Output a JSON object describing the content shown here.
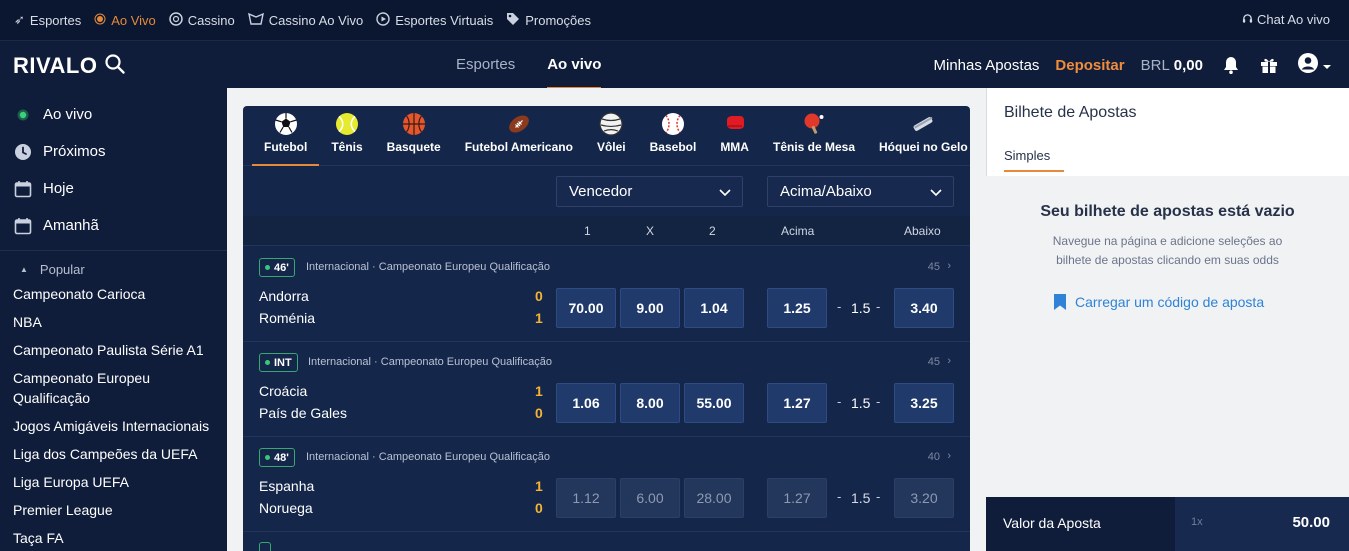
{
  "topbar": {
    "items": [
      {
        "label": "Esportes",
        "icon": "sports-icon"
      },
      {
        "label": "Ao Vivo",
        "icon": "live-dot-icon"
      },
      {
        "label": "Cassino",
        "icon": "casino-chip-icon"
      },
      {
        "label": "Cassino Ao Vivo",
        "icon": "live-casino-icon"
      },
      {
        "label": "Esportes Virtuais",
        "icon": "virtual-sports-icon"
      },
      {
        "label": "Promoções",
        "icon": "tag-icon"
      }
    ],
    "chat_label": "Chat Ao vivo"
  },
  "header": {
    "logo": "RIVALO",
    "nav": [
      "Esportes",
      "Ao vivo"
    ],
    "minhas_apostas": "Minhas Apostas",
    "depositar": "Depositar",
    "balance_currency": "BRL",
    "balance_value": "0,00"
  },
  "sidebar": {
    "items": [
      {
        "label": "Ao vivo",
        "icon": "live-dot-icon"
      },
      {
        "label": "Próximos",
        "icon": "clock-icon"
      },
      {
        "label": "Hoje",
        "icon": "calendar-icon"
      },
      {
        "label": "Amanhã",
        "icon": "calendar-icon"
      }
    ],
    "popular_label": "Popular",
    "leagues": [
      "Campeonato Carioca",
      "NBA",
      "Campeonato Paulista Série A1",
      "Campeonato Europeu Qualificação",
      "Jogos Amigáveis Internacionais",
      "Liga dos Campeões da UEFA",
      "Liga Europa UEFA",
      "Premier League",
      "Taça FA"
    ]
  },
  "sports": [
    {
      "label": "Futebol",
      "icon": "soccer-ball-icon"
    },
    {
      "label": "Tênis",
      "icon": "tennis-ball-icon"
    },
    {
      "label": "Basquete",
      "icon": "basketball-icon"
    },
    {
      "label": "Futebol Americano",
      "icon": "american-football-icon"
    },
    {
      "label": "Vôlei",
      "icon": "volleyball-icon"
    },
    {
      "label": "Basebol",
      "icon": "baseball-icon"
    },
    {
      "label": "MMA",
      "icon": "mma-glove-icon"
    },
    {
      "label": "Tênis de Mesa",
      "icon": "table-tennis-icon"
    },
    {
      "label": "Hóquei no Gelo",
      "icon": "ice-hockey-icon"
    }
  ],
  "markets": {
    "select1": "Vencedor",
    "select2": "Acima/Abaixo",
    "col_1": "1",
    "col_x": "X",
    "col_2": "2",
    "col_acima": "Acima",
    "col_abaixo": "Abaixo"
  },
  "matches": [
    {
      "tag": "46'",
      "competition": "Internacional · Campeonato Europeu Qualificação",
      "count": "45",
      "home": "Andorra",
      "away": "Roménia",
      "home_score": "0",
      "away_score": "1",
      "odd_1": "70.00",
      "odd_x": "9.00",
      "odd_2": "1.04",
      "acima": "1.25",
      "line": "1.5",
      "abaixo": "3.40",
      "suspended": false
    },
    {
      "tag": "INT",
      "competition": "Internacional · Campeonato Europeu Qualificação",
      "count": "45",
      "home": "Croácia",
      "away": "País de Gales",
      "home_score": "1",
      "away_score": "0",
      "odd_1": "1.06",
      "odd_x": "8.00",
      "odd_2": "55.00",
      "acima": "1.27",
      "line": "1.5",
      "abaixo": "3.25",
      "suspended": false
    },
    {
      "tag": "48'",
      "competition": "Internacional · Campeonato Europeu Qualificação",
      "count": "40",
      "home": "Espanha",
      "away": "Noruega",
      "home_score": "1",
      "away_score": "0",
      "odd_1": "1.12",
      "odd_x": "6.00",
      "odd_2": "28.00",
      "acima": "1.27",
      "line": "1.5",
      "abaixo": "3.20",
      "suspended": true
    }
  ],
  "betslip": {
    "title": "Bilhete de Apostas",
    "tab": "Simples",
    "empty_title": "Seu bilhete de apostas está vazio",
    "empty_text": "Navegue na página e adicione seleções ao bilhete de apostas clicando em suas odds",
    "load_code": "Carregar um código de aposta",
    "stake_label": "Valor da Aposta",
    "stake_mult": "1x",
    "stake_value": "50.00"
  },
  "colors": {
    "accent": "#e58a3a",
    "navy": "#0f1d3a",
    "panel": "#14264a",
    "odd_bg": "#203a6b",
    "score": "#f5b234",
    "link": "#2e83d6"
  }
}
